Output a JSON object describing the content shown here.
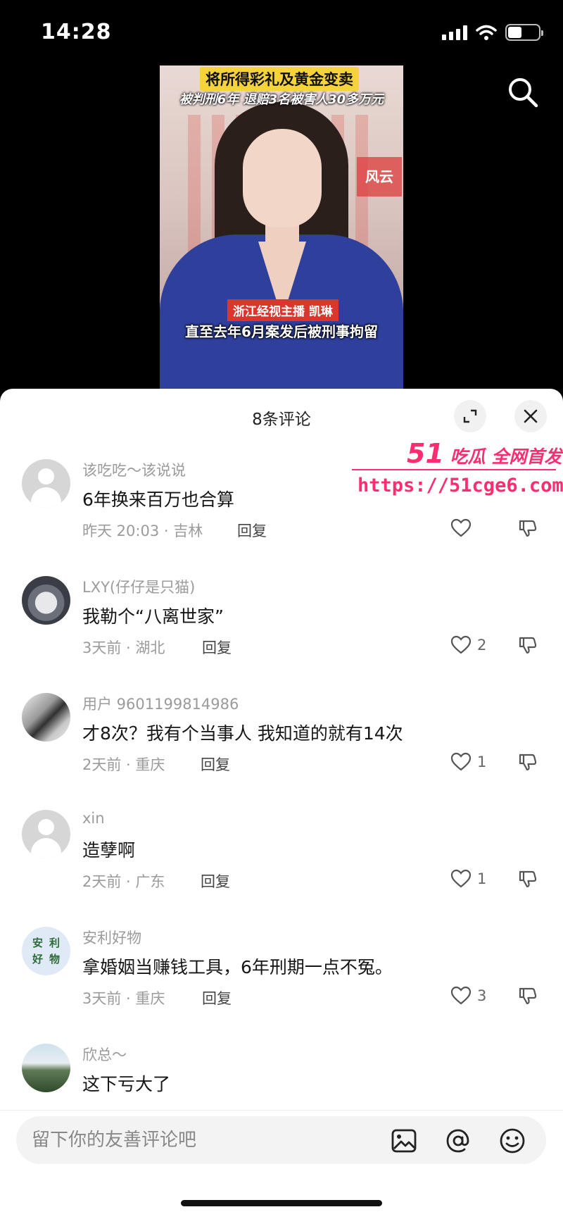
{
  "status_bar": {
    "time": "14:28"
  },
  "video": {
    "caption_top": "将所得彩礼及黄金变卖",
    "caption_top2": "被判刑6年 退赔3名被害人30多万元",
    "name_tag": "浙江经视主播 凯琳",
    "caption_bottom": "直至去年6月案发后被刑事拘留",
    "logo_text": "风云"
  },
  "comments_header": {
    "title": "8条评论"
  },
  "watermark": {
    "brand": "51",
    "slogan": "吃瓜 全网首发",
    "url": "https://51cge6.com"
  },
  "comments": [
    {
      "user": "该吃吃～该说说",
      "text": "6年换来百万也合算",
      "meta": "昨天 20:03 · 吉林",
      "reply": "回复",
      "likes": ""
    },
    {
      "user": "LXY(仔仔是只猫)",
      "text": "我勒个“八离世家”",
      "meta": "3天前 · 湖北",
      "reply": "回复",
      "likes": "2"
    },
    {
      "user": "用户 9601199814986",
      "text": "才8次？我有个当事人 我知道的就有14次",
      "meta": "2天前 · 重庆",
      "reply": "回复",
      "likes": "1"
    },
    {
      "user": "xin",
      "text": "造孽啊",
      "meta": "2天前 · 广东",
      "reply": "回复",
      "likes": "1"
    },
    {
      "user": "安利好物",
      "text": "拿婚姻当赚钱工具，6年刑期一点不冤。",
      "meta": "3天前 · 重庆",
      "reply": "回复",
      "likes": "3",
      "avatar_text": [
        "安",
        "利",
        "好",
        "物"
      ]
    },
    {
      "user": "欣总～",
      "text": "这下亏大了",
      "meta": "",
      "reply": "",
      "likes": ""
    }
  ],
  "input": {
    "placeholder": "留下你的友善评论吧"
  },
  "icons": {
    "search": "search-icon",
    "expand": "expand-icon",
    "close": "close-icon",
    "like": "heart-icon",
    "dislike": "thumbs-down-icon",
    "image": "image-icon",
    "mention": "at-icon",
    "emoji": "emoji-icon"
  },
  "colors": {
    "accent": "#ff2d6f",
    "sheet_bg": "#ffffff",
    "muted_text": "#9b9b9b"
  }
}
